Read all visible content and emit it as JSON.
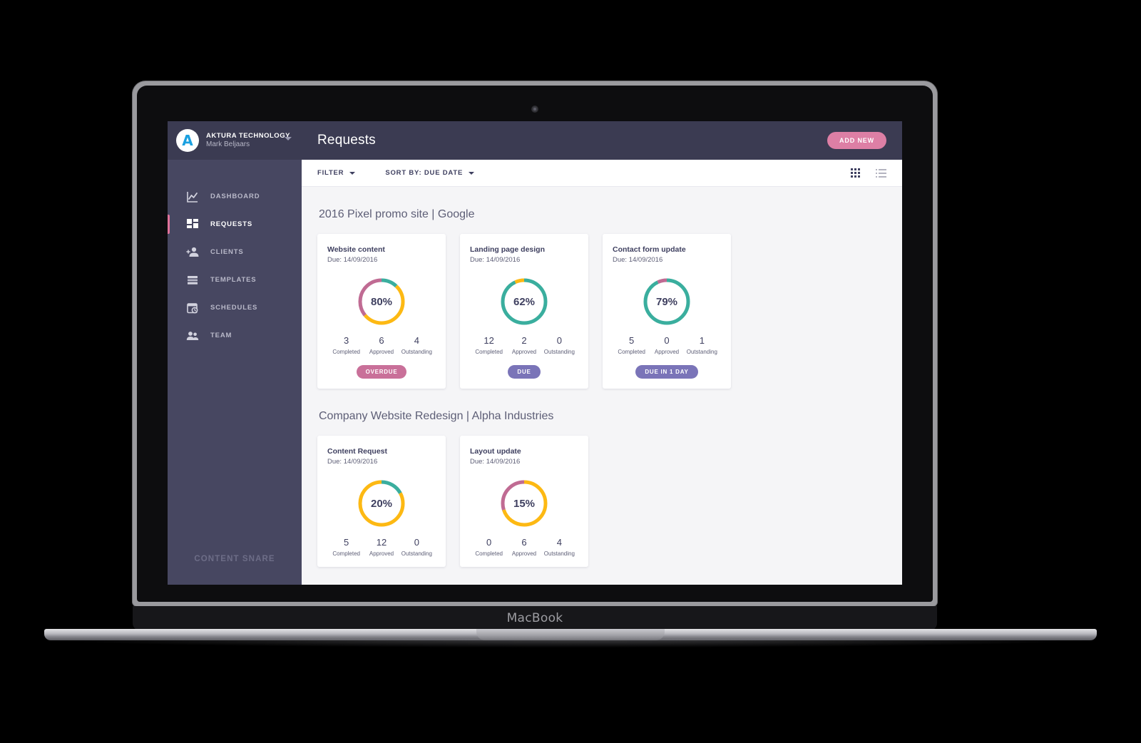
{
  "device": {
    "label": "MacBook"
  },
  "sidebar": {
    "brand": {
      "avatar_letter": "A",
      "org": "AKTURA TECHNOLOGY",
      "user": "Mark Beljaars"
    },
    "items": [
      {
        "label": "DASHBOARD",
        "icon": "chart-line-icon",
        "active": false
      },
      {
        "label": "REQUESTS",
        "icon": "grid-blocks-icon",
        "active": true
      },
      {
        "label": "CLIENTS",
        "icon": "user-add-icon",
        "active": false
      },
      {
        "label": "TEMPLATES",
        "icon": "layers-icon",
        "active": false
      },
      {
        "label": "SCHEDULES",
        "icon": "calendar-clock-icon",
        "active": false
      },
      {
        "label": "TEAM",
        "icon": "users-icon",
        "active": false
      }
    ],
    "footer_logo": "CONTENT SNARE"
  },
  "header": {
    "title": "Requests",
    "add_new_label": "ADD NEW"
  },
  "toolbar": {
    "filter_label": "FILTER",
    "sort_label": "SORT BY: DUE DATE",
    "grid_view_icon": "grid-view-icon",
    "list_view_icon": "list-view-icon"
  },
  "colors": {
    "accent_pink": "#dd7fa5",
    "badge_overdue": "#c97099",
    "badge_due": "#7a74b8",
    "donut_teal": "#3aae9e",
    "donut_yellow": "#fdb913",
    "donut_pink": "#c06b93",
    "donut_track": "#f0f0f3",
    "sidebar": "#474761",
    "topbar": "#3b3b52"
  },
  "sections": [
    {
      "title": "2016 Pixel promo site | Google",
      "cards": [
        {
          "title": "Website content",
          "due": "Due: 14/09/2016",
          "percent": "80%",
          "donut": {
            "teal": 12,
            "yellow": 52,
            "pink": 36
          },
          "stats": [
            {
              "value": "3",
              "label": "Completed"
            },
            {
              "value": "6",
              "label": "Approved"
            },
            {
              "value": "4",
              "label": "Outstanding"
            }
          ],
          "badge": {
            "label": "OVERDUE",
            "style": "overdue"
          }
        },
        {
          "title": "Landing page design",
          "due": "Due: 14/09/2016",
          "percent": "62%",
          "donut": {
            "teal": 93,
            "yellow": 7,
            "pink": 0
          },
          "stats": [
            {
              "value": "12",
              "label": "Completed"
            },
            {
              "value": "2",
              "label": "Approved"
            },
            {
              "value": "0",
              "label": "Outstanding"
            }
          ],
          "badge": {
            "label": "DUE",
            "style": "due"
          }
        },
        {
          "title": "Contact form update",
          "due": "Due: 14/09/2016",
          "percent": "79%",
          "donut": {
            "teal": 93,
            "yellow": 0,
            "pink": 7
          },
          "stats": [
            {
              "value": "5",
              "label": "Completed"
            },
            {
              "value": "0",
              "label": "Approved"
            },
            {
              "value": "1",
              "label": "Outstanding"
            }
          ],
          "badge": {
            "label": "DUE IN 1 DAY",
            "style": "due1"
          }
        }
      ]
    },
    {
      "title": "Company Website Redesign | Alpha Industries",
      "cards": [
        {
          "title": "Content Request",
          "due": "Due: 14/09/2016",
          "percent": "20%",
          "donut": {
            "teal": 17,
            "yellow": 83,
            "pink": 0
          },
          "stats": [
            {
              "value": "5",
              "label": "Completed"
            },
            {
              "value": "12",
              "label": "Approved"
            },
            {
              "value": "0",
              "label": "Outstanding"
            }
          ],
          "badge": null
        },
        {
          "title": "Layout update",
          "due": "Due: 14/09/2016",
          "percent": "15%",
          "donut": {
            "teal": 0,
            "yellow": 70,
            "pink": 30
          },
          "stats": [
            {
              "value": "0",
              "label": "Completed"
            },
            {
              "value": "6",
              "label": "Approved"
            },
            {
              "value": "4",
              "label": "Outstanding"
            }
          ],
          "badge": null
        }
      ]
    }
  ],
  "chart_data": [
    {
      "type": "pie",
      "title": "Website content",
      "labels": [
        "Completed",
        "Approved",
        "Outstanding"
      ],
      "values": [
        3,
        6,
        4
      ],
      "center_label": "80%",
      "segments_pct": [
        12,
        52,
        36
      ],
      "segment_colors": [
        "#3aae9e",
        "#fdb913",
        "#c06b93"
      ]
    },
    {
      "type": "pie",
      "title": "Landing page design",
      "labels": [
        "Completed",
        "Approved",
        "Outstanding"
      ],
      "values": [
        12,
        2,
        0
      ],
      "center_label": "62%",
      "segments_pct": [
        93,
        7,
        0
      ],
      "segment_colors": [
        "#3aae9e",
        "#fdb913",
        "#c06b93"
      ]
    },
    {
      "type": "pie",
      "title": "Contact form update",
      "labels": [
        "Completed",
        "Approved",
        "Outstanding"
      ],
      "values": [
        5,
        0,
        1
      ],
      "center_label": "79%",
      "segments_pct": [
        93,
        0,
        7
      ],
      "segment_colors": [
        "#3aae9e",
        "#fdb913",
        "#c06b93"
      ]
    },
    {
      "type": "pie",
      "title": "Content Request",
      "labels": [
        "Completed",
        "Approved",
        "Outstanding"
      ],
      "values": [
        5,
        12,
        0
      ],
      "center_label": "20%",
      "segments_pct": [
        17,
        83,
        0
      ],
      "segment_colors": [
        "#3aae9e",
        "#fdb913",
        "#c06b93"
      ]
    },
    {
      "type": "pie",
      "title": "Layout update",
      "labels": [
        "Completed",
        "Approved",
        "Outstanding"
      ],
      "values": [
        0,
        6,
        4
      ],
      "center_label": "15%",
      "segments_pct": [
        0,
        70,
        30
      ],
      "segment_colors": [
        "#3aae9e",
        "#fdb913",
        "#c06b93"
      ]
    }
  ]
}
